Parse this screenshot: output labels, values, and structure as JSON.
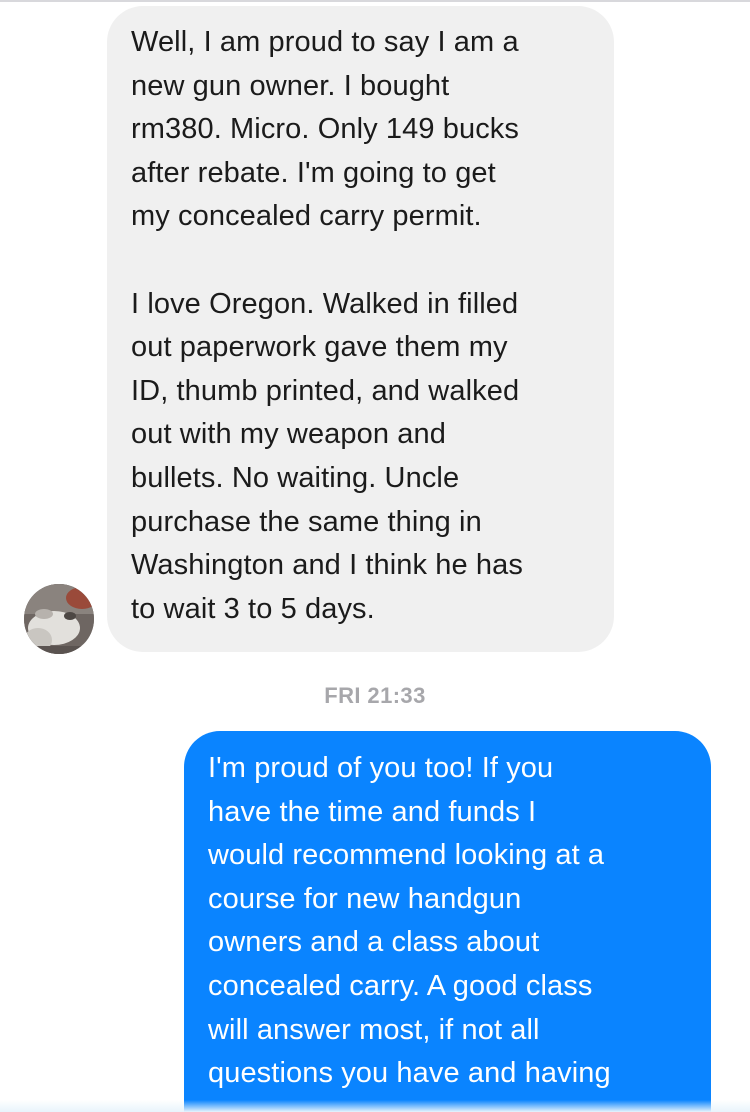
{
  "thread": {
    "messages": [
      {
        "direction": "incoming",
        "text": "Well, I am proud to say I am a\nnew gun owner. I bought\nrm380. Micro. Only 149 bucks\nafter rebate. I'm going to get\nmy concealed carry permit.\n\nI love Oregon. Walked in filled\nout paperwork gave them my\nID, thumb printed, and walked\nout with my weapon and\nbullets. No waiting. Uncle\npurchase the same thing in\nWashington and I think he has\nto wait 3 to 5 days."
      },
      {
        "direction": "outgoing",
        "text": "I'm proud of you too! If you\nhave the time and funds I\nwould recommend looking at a\ncourse for new handgun\nowners and a class about\nconcealed carry. A good class\nwill answer most, if not all\nquestions you have and having"
      }
    ],
    "timestamp": "FRI 21:33"
  },
  "colors": {
    "incoming_bubble": "#f0f0f0",
    "outgoing_bubble": "#0a84ff",
    "timestamp_text": "#a7a7ab"
  },
  "icons": {
    "sender_avatar": "profile-photo-avatar"
  }
}
